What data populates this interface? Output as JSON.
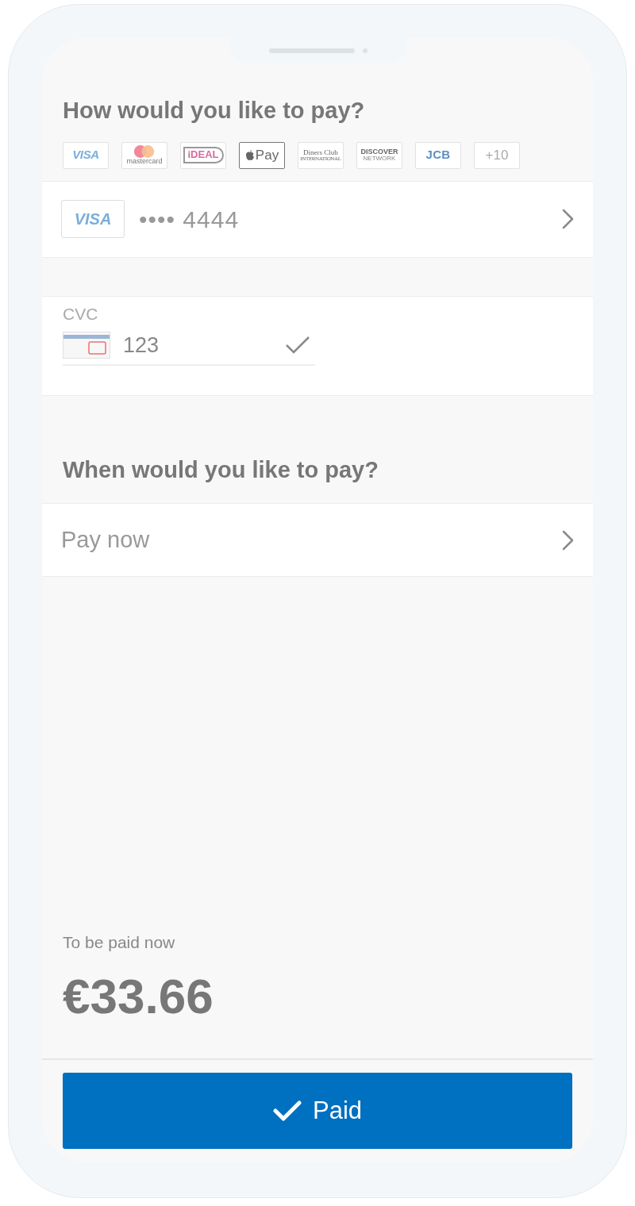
{
  "payment_section": {
    "title": "How would you like to pay?",
    "methods": [
      {
        "kind": "visa",
        "label": "VISA",
        "selected": false
      },
      {
        "kind": "mastercard",
        "label": "mastercard",
        "selected": false
      },
      {
        "kind": "ideal",
        "label": "iDEAL",
        "selected": false
      },
      {
        "kind": "applepay",
        "label": "Pay",
        "selected": true
      },
      {
        "kind": "diners",
        "label": "Diners Club",
        "sublabel": "INTERNATIONAL",
        "selected": false
      },
      {
        "kind": "discover",
        "label": "DISCOVER",
        "sublabel": "NETWORK",
        "selected": false
      },
      {
        "kind": "jcb",
        "label": "JCB",
        "selected": false
      },
      {
        "kind": "more",
        "label": "+10",
        "selected": false
      }
    ]
  },
  "card": {
    "brand": "VISA",
    "number": "•••• 4444"
  },
  "cvc": {
    "label": "CVC",
    "value": "123",
    "valid": true
  },
  "timing_section": {
    "title": "When would you like to pay?",
    "option": "Pay now"
  },
  "total": {
    "label": "To be paid now",
    "amount": "€33.66"
  },
  "button": {
    "label": "Paid",
    "done": true
  }
}
